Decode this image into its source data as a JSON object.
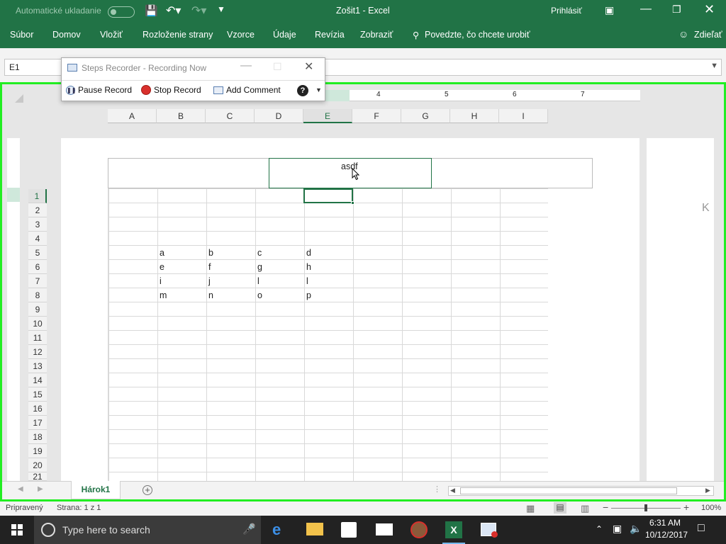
{
  "titlebar": {
    "autosave_label": "Automatické ukladanie",
    "title": "Zošit1  -  Excel",
    "signin": "Prihlásiť"
  },
  "ribbon": {
    "tabs": [
      "Súbor",
      "Domov",
      "Vložiť",
      "Rozloženie strany",
      "Vzorce",
      "Údaje",
      "Revízia",
      "Zobraziť"
    ],
    "tell_me": "Povedzte, čo chcete urobiť",
    "share": "Zdieľať"
  },
  "formula_bar": {
    "name_box": "E1"
  },
  "steps_recorder": {
    "title": "Steps Recorder - Recording Now",
    "pause": "Pause Record",
    "stop": "Stop Record",
    "comment": "Add Comment"
  },
  "ruler": {
    "marks": [
      "4",
      "5",
      "6",
      "7"
    ]
  },
  "columns": [
    "A",
    "B",
    "C",
    "D",
    "E",
    "F",
    "G",
    "H",
    "I"
  ],
  "selected_column": "E",
  "rows": [
    "1",
    "2",
    "3",
    "4",
    "5",
    "6",
    "7",
    "8",
    "9",
    "10",
    "11",
    "12",
    "13",
    "14",
    "15",
    "16",
    "17",
    "18",
    "19",
    "20",
    "21"
  ],
  "selected_row": "1",
  "header_text": "asdf",
  "cells": [
    [
      "a",
      "b",
      "c",
      "d"
    ],
    [
      "e",
      "f",
      "g",
      "h"
    ],
    [
      "i",
      "j",
      "l",
      "l"
    ],
    [
      "m",
      "n",
      "o",
      "p"
    ]
  ],
  "sheet_tab": "Hárok1",
  "status": {
    "ready": "Pripravený",
    "page": "Strana: 1 z 1",
    "zoom": "100%"
  },
  "taskbar": {
    "search_placeholder": "Type here to search",
    "time": "6:31 AM",
    "date": "10/12/2017"
  },
  "colors": {
    "excel_green": "#217346",
    "record_frame": "#22ee22"
  }
}
